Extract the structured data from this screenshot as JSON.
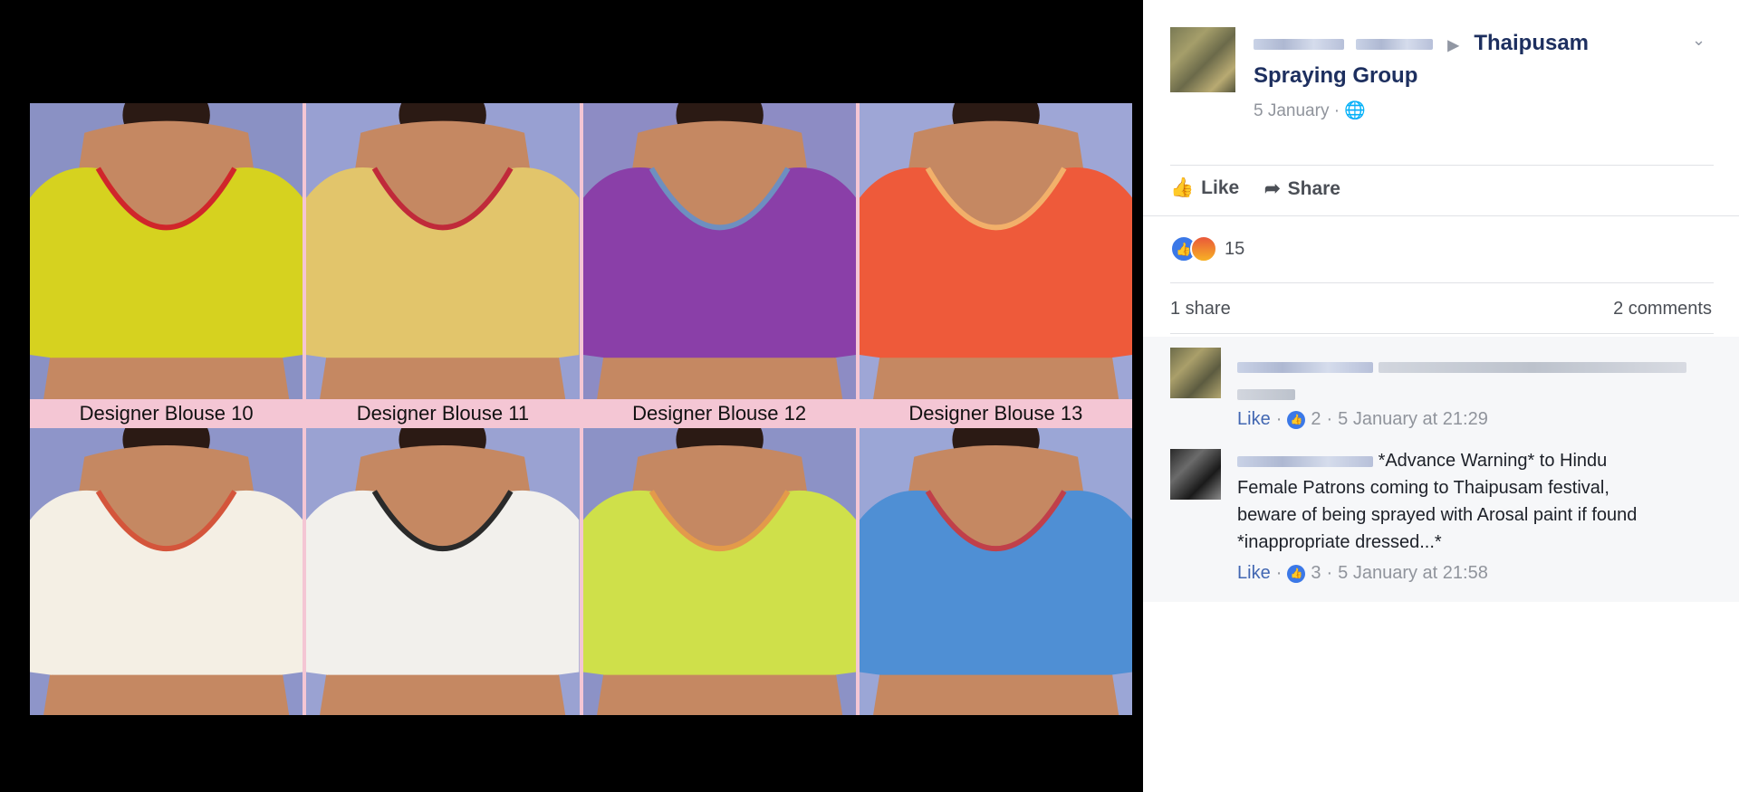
{
  "photo": {
    "tiles": [
      {
        "caption": "Designer Blouse 10",
        "bg": "#8a91c4",
        "blouse": "#d6d21f",
        "accent": "#d0262b"
      },
      {
        "caption": "Designer Blouse 11",
        "bg": "#98a0d2",
        "blouse": "#e2c56b",
        "accent": "#c02a3a"
      },
      {
        "caption": "Designer Blouse 12",
        "bg": "#8d8cc4",
        "blouse": "#8a3fa8",
        "accent": "#6e8fc0"
      },
      {
        "caption": "Designer Blouse 13",
        "bg": "#9ea6d6",
        "blouse": "#ee5a3a",
        "accent": "#f2b06a"
      },
      {
        "caption": "",
        "bg": "#8e95c9",
        "blouse": "#f4efe4",
        "accent": "#d4553b"
      },
      {
        "caption": "",
        "bg": "#9aa2d2",
        "blouse": "#f2f0ec",
        "accent": "#2a2a2a"
      },
      {
        "caption": "",
        "bg": "#8c92c6",
        "blouse": "#cfe04a",
        "accent": "#e39a4a"
      },
      {
        "caption": "",
        "bg": "#9ba6d6",
        "blouse": "#4f8fd4",
        "accent": "#c0404a"
      }
    ]
  },
  "post": {
    "group_name_line1": "Thaipusam",
    "group_name_line2": "Spraying Group",
    "date": "5 January",
    "date_sep": "·",
    "actions": {
      "like": "Like",
      "share": "Share"
    },
    "reaction_count": "15",
    "share_count": "1 share",
    "comment_count": "2 comments"
  },
  "comments": [
    {
      "text": "",
      "like_label": "Like",
      "likes": "2",
      "time": "5 January at 21:29"
    },
    {
      "text_line1": "*Advance Warning* to Hindu",
      "text_line2": "Female Patrons coming to Thaipusam festival,",
      "text_line3": "beware of being sprayed with Arosal paint if found",
      "text_line4": "*inappropriate dressed...*",
      "like_label": "Like",
      "likes": "3",
      "time": "5 January at 21:58"
    }
  ],
  "colors": {
    "link": "#1d2f5f",
    "meta": "#90949c",
    "like_blue": "#4267b2"
  }
}
